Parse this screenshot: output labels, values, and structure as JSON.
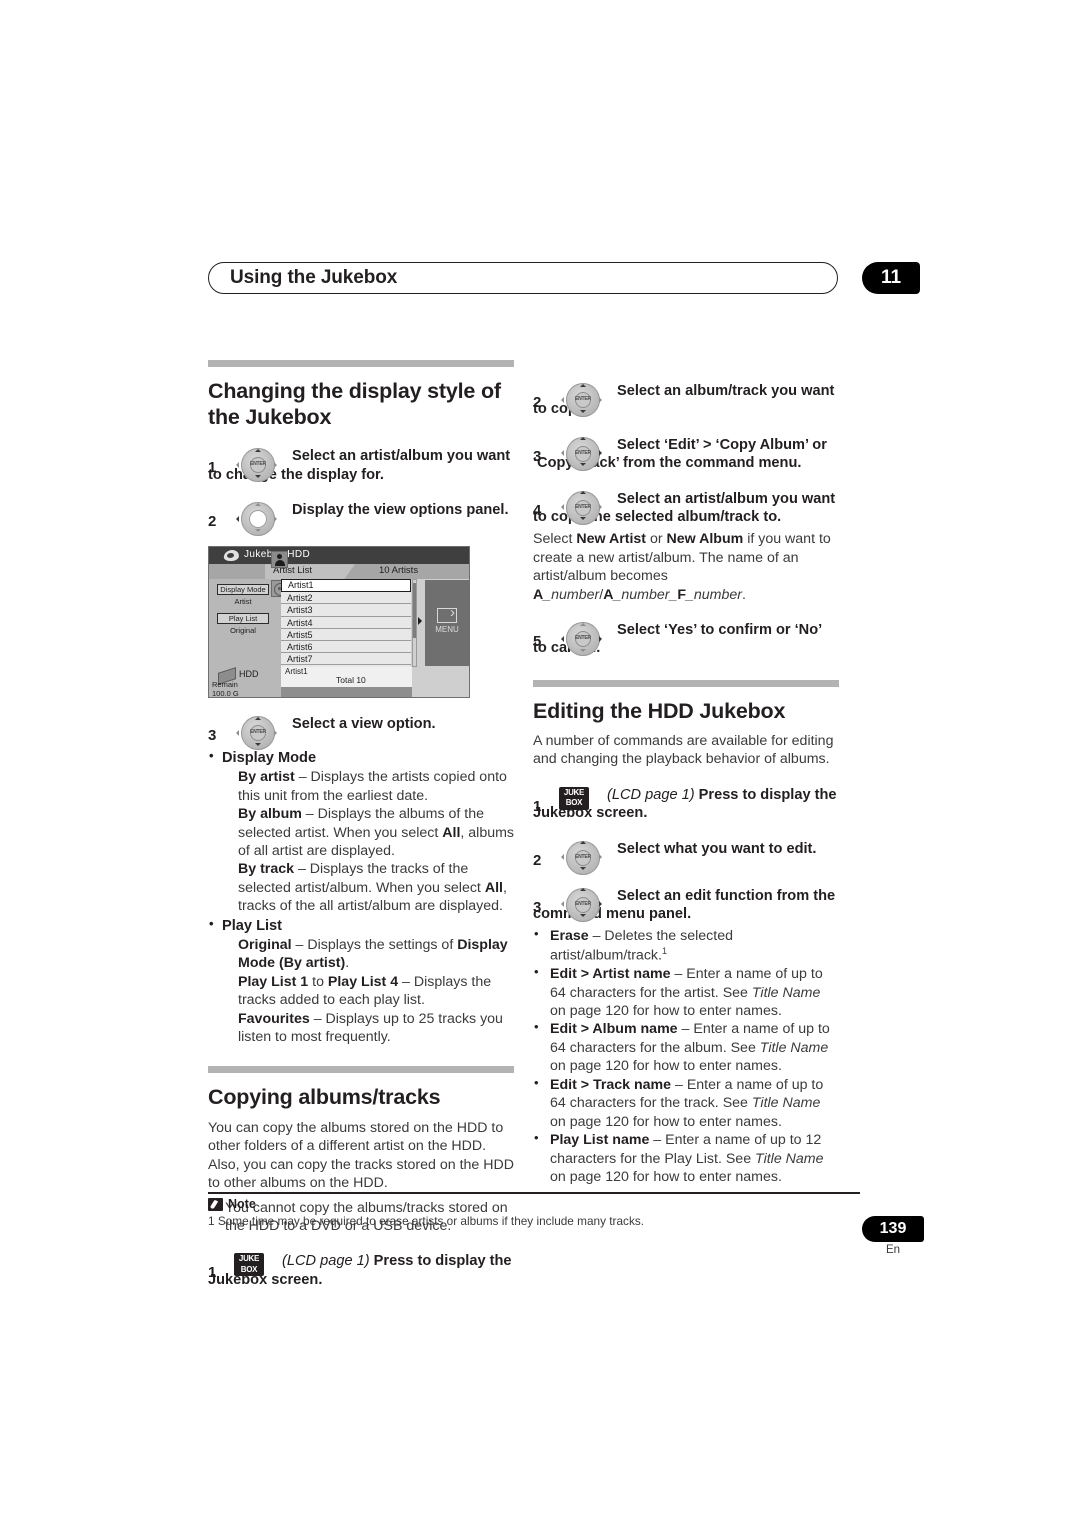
{
  "header": {
    "title": "Using the Jukebox",
    "chapter": "11"
  },
  "left_column": {
    "section1": {
      "heading": "Changing the display style of the Jukebox",
      "steps": [
        {
          "num": "1",
          "icon": "dpad-enter-icon",
          "text": "Select an artist/album you want to change the display for."
        },
        {
          "num": "2",
          "icon": "dpad-hollow-icon",
          "text": "Display the view options panel."
        },
        {
          "num": "3",
          "icon": "dpad-enter-icon",
          "text": "Select a view option."
        }
      ],
      "options": [
        {
          "label": "Display Mode",
          "entries": [
            {
              "term": "By artist",
              "desc": " – Displays the artists copied onto this unit from the earliest date."
            },
            {
              "term": "By album",
              "desc_1": " – Displays the albums of the selected artist. When you select ",
              "bold_2": "All",
              "desc_2": ", albums of all artist are displayed."
            },
            {
              "term": "By track",
              "desc_1": " – Displays the tracks of the selected artist/album. When you select ",
              "bold_2": "All",
              "desc_2": ", tracks of the all artist/album are displayed."
            }
          ]
        },
        {
          "label": "Play List",
          "entries": [
            {
              "term": "Original",
              "desc_1": " – Displays the settings of ",
              "bold_2": "Display Mode (By artist)",
              "desc_2": "."
            },
            {
              "term": "Play List 1",
              "mid": " to ",
              "term2": "Play List 4",
              "desc": " – Displays the tracks added to each play list."
            },
            {
              "term": "Favourites",
              "desc": " – Displays up to 25 tracks you listen to most frequently."
            }
          ]
        }
      ]
    },
    "section2": {
      "heading": "Copying albums/tracks",
      "intro": "You can copy the albums stored on the HDD to other folders of a different artist on the HDD. Also, you can copy the tracks stored on the HDD to other albums on the HDD.",
      "bullet": "You cannot copy the albums/tracks stored on the HDD to a DVD or a USB device.",
      "step1": {
        "num": "1",
        "icon": "juke-box-key-icon",
        "lcd": "(LCD page 1)",
        "text": " Press to display the Jukebox screen."
      }
    }
  },
  "jukebox_screen": {
    "title": "Jukebox  HDD",
    "tab_label": "Artist List",
    "count_label": "10 Artists",
    "display_mode_label": "Display Mode",
    "display_mode_value": "Artist",
    "play_list_label": "Play List",
    "play_list_value": "Original",
    "rows": [
      "Artist1",
      "Artist2",
      "Artist3",
      "Artist4",
      "Artist5",
      "Artist6",
      "Artist7"
    ],
    "menu_label": "MENU",
    "hdd_label": "HDD",
    "remain_label": "Remain",
    "remain_value": "100.0 G",
    "now_artist": "Artist1",
    "total_label": "Total   10"
  },
  "right_column": {
    "copy_steps": [
      {
        "num": "2",
        "icon": "dpad-enter-icon",
        "text": "Select an album/track you want to copy."
      },
      {
        "num": "3",
        "icon": "dpad-enter-icon",
        "text": "Select ‘Edit’ > ‘Copy Album’ or ‘Copy Track’ from the command menu."
      },
      {
        "num": "4",
        "icon": "dpad-enter-icon",
        "text": "Select an artist/album you want to copy the selected album/track to."
      }
    ],
    "step4_note_1": "Select ",
    "step4_note_b1": "New Artist",
    "step4_note_2": " or ",
    "step4_note_b2": "New Album",
    "step4_note_3": " if you want to create a new artist/album. The name of an artist/album becomes ",
    "step4_note_b3": "A",
    "step4_note_i1": "_number",
    "step4_note_4": "/",
    "step4_note_b4": "A",
    "step4_note_i2": "_number_",
    "step4_note_b5": "F",
    "step4_note_i3": "_number",
    "step4_note_5": ".",
    "step5": {
      "num": "5",
      "icon": "dpad-enter-icon",
      "text": "Select ‘Yes’ to confirm or ‘No’ to cancel."
    },
    "section": {
      "heading": "Editing the HDD Jukebox",
      "intro": "A number of commands are available for editing and changing the playback behavior of albums.",
      "steps": [
        {
          "num": "1",
          "icon": "juke-box-key-icon",
          "lcd": "(LCD page 1)",
          "text": " Press to display the Jukebox screen."
        },
        {
          "num": "2",
          "icon": "dpad-enter-icon",
          "text": "Select what you want to edit."
        },
        {
          "num": "3",
          "icon": "dpad-enter-icon",
          "text": "Select an edit function from the command menu panel."
        }
      ],
      "functions": [
        {
          "term": "Erase",
          "desc": " – Deletes the selected artist/album/track.",
          "footnote": "1"
        },
        {
          "term": "Edit > Artist name",
          "desc_1": " – Enter a name of up to 64 characters for the artist. See ",
          "ital": "Title Name",
          "desc_2": " on page 120 for how to enter names."
        },
        {
          "term": "Edit > Album name",
          "desc_1": " – Enter a name of up to 64 characters for the album. See ",
          "ital": "Title Name",
          "desc_2": " on page 120 for how to enter names."
        },
        {
          "term": "Edit > Track name",
          "desc_1": " – Enter a name of up to 64 characters for the track. See ",
          "ital": "Title Name",
          "desc_2": " on page 120 for how to enter names."
        },
        {
          "term": "Play List name",
          "desc_1": " – Enter a name of up to 12 characters for the Play List. See ",
          "ital": "Title Name",
          "desc_2": " on page 120 for how to enter names."
        }
      ]
    }
  },
  "note": {
    "heading": "Note",
    "text": "1 Some time may be required to erase artists or albums if they include many tracks."
  },
  "folio": {
    "page": "139",
    "lang": "En"
  },
  "icons": {
    "dpad_center_label": "ENTER",
    "juke_line1": "JUKE",
    "juke_line2": "BOX"
  }
}
